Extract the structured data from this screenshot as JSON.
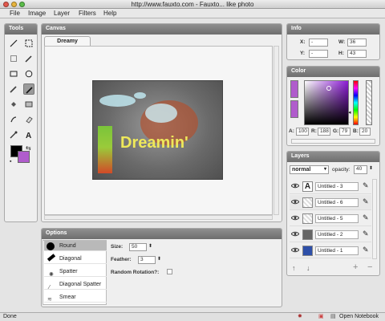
{
  "window": {
    "title": "http://www.fauxto.com - Fauxto... like photo"
  },
  "menu": [
    "File",
    "Image",
    "Layer",
    "Filters",
    "Help"
  ],
  "tools": {
    "title": "Tools"
  },
  "canvas": {
    "title": "Canvas",
    "tab": "Dreamy",
    "image_text": "Dreamin'"
  },
  "info": {
    "title": "Info",
    "x_label": "X:",
    "x_value": "-",
    "y_label": "Y:",
    "y_value": "-",
    "w_label": "W:",
    "w_value": "36",
    "h_label": "H:",
    "h_value": "43"
  },
  "color": {
    "title": "Color",
    "a_label": "A:",
    "a_value": "100",
    "r_label": "R:",
    "r_value": "188",
    "g_label": "G:",
    "g_value": "79",
    "b_label": "B:",
    "b_value": "20"
  },
  "layers": {
    "title": "Layers",
    "blend_mode": "normal",
    "opacity_label": "opacity:",
    "opacity_value": "40",
    "items": [
      {
        "name": "Untitled - 3",
        "thumb": "A"
      },
      {
        "name": "Untitled - 6",
        "thumb": ""
      },
      {
        "name": "Untitled - 5",
        "thumb": ""
      },
      {
        "name": "Untitled - 2",
        "thumb": ""
      },
      {
        "name": "Untitled - 1",
        "thumb": ""
      }
    ]
  },
  "options": {
    "title": "Options",
    "brushes": [
      "Round",
      "Diagonal",
      "Spatter",
      "Diagonal Spatter",
      "Smear"
    ],
    "size_label": "Size:",
    "size_value": "50",
    "feather_label": "Feather:",
    "feather_value": "3",
    "rotation_label": "Random Rotation?:"
  },
  "status": {
    "left": "Done",
    "right": "Open Notebook"
  },
  "colors": {
    "foreground": "#000000",
    "background": "#b05ccc",
    "hue_accent": "#5a2a78"
  }
}
